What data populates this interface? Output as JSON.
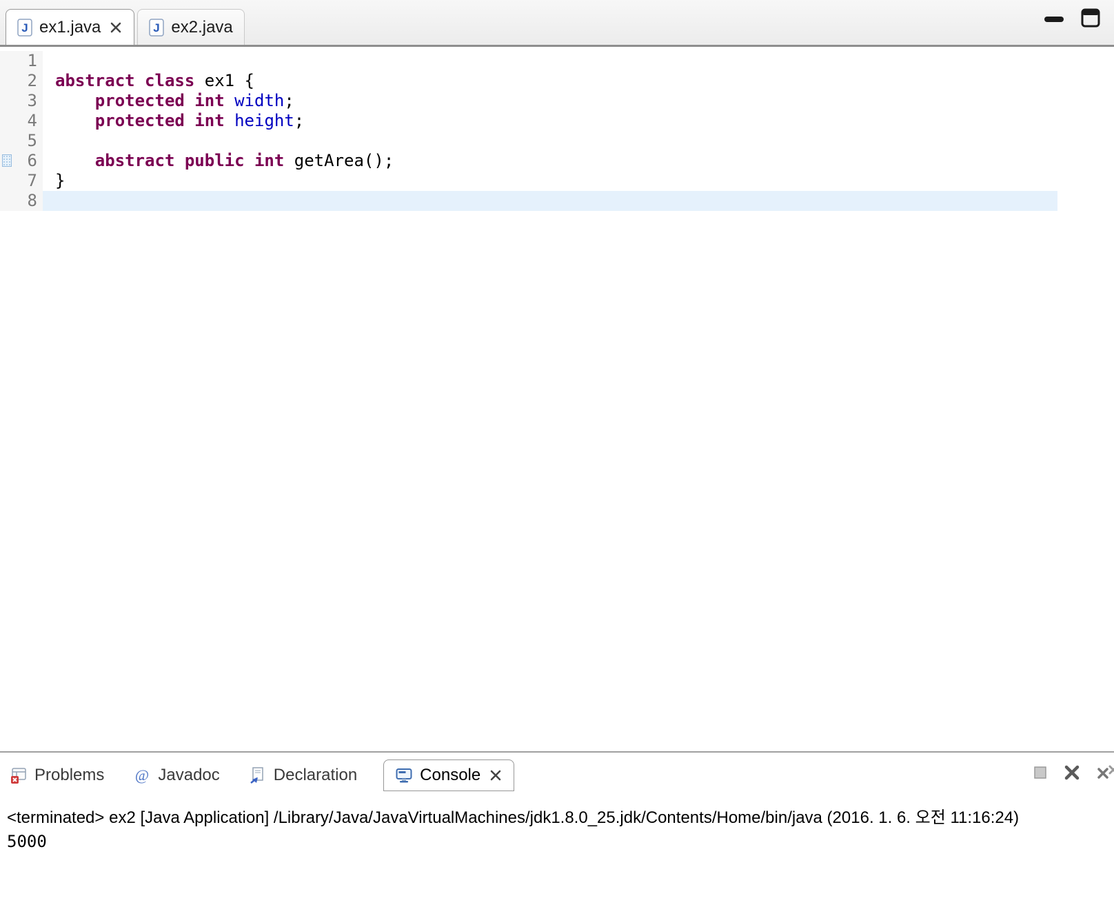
{
  "window": {
    "controls": [
      {
        "icon": "minimize-icon"
      },
      {
        "icon": "maximize-icon"
      }
    ]
  },
  "editor": {
    "tabs": [
      {
        "icon": "java-file-icon",
        "label": "ex1.java",
        "active": true,
        "closable": true,
        "close_icon": "close-icon"
      },
      {
        "icon": "java-file-icon",
        "label": "ex2.java",
        "active": false,
        "closable": false
      }
    ],
    "marker_line": 6,
    "current_line": 8,
    "lines": [
      {
        "num": "1",
        "tokens": []
      },
      {
        "num": "2",
        "tokens": [
          {
            "t": "kw",
            "s": "abstract class "
          },
          {
            "t": "pl",
            "s": "ex1 {"
          }
        ]
      },
      {
        "num": "3",
        "tokens": [
          {
            "t": "pl",
            "s": "    "
          },
          {
            "t": "kw",
            "s": "protected int "
          },
          {
            "t": "field",
            "s": "width"
          },
          {
            "t": "pl",
            "s": ";"
          }
        ]
      },
      {
        "num": "4",
        "tokens": [
          {
            "t": "pl",
            "s": "    "
          },
          {
            "t": "kw",
            "s": "protected int "
          },
          {
            "t": "field",
            "s": "height"
          },
          {
            "t": "pl",
            "s": ";"
          }
        ]
      },
      {
        "num": "5",
        "tokens": []
      },
      {
        "num": "6",
        "tokens": [
          {
            "t": "pl",
            "s": "    "
          },
          {
            "t": "kw",
            "s": "abstract public int "
          },
          {
            "t": "pl",
            "s": "getArea();"
          }
        ]
      },
      {
        "num": "7",
        "tokens": [
          {
            "t": "pl",
            "s": "}"
          }
        ]
      },
      {
        "num": "8",
        "tokens": []
      }
    ]
  },
  "console": {
    "tabs": [
      {
        "icon": "problems-icon",
        "label": "Problems",
        "active": false
      },
      {
        "icon": "javadoc-icon",
        "label": "Javadoc",
        "active": false
      },
      {
        "icon": "declaration-icon",
        "label": "Declaration",
        "active": false
      },
      {
        "icon": "console-icon",
        "label": "Console",
        "active": true,
        "closable": true,
        "close_icon": "close-icon"
      }
    ],
    "toolbar": [
      {
        "icon": "gray-square-icon"
      },
      {
        "icon": "close-console-icon"
      },
      {
        "icon": "remove-all-terminated-icon"
      }
    ],
    "header": "<terminated> ex2 [Java Application] /Library/Java/JavaVirtualMachines/jdk1.8.0_25.jdk/Contents/Home/bin/java (2016. 1. 6. 오전 11:16:24)",
    "output": "5000"
  },
  "colors": {
    "keyword": "#7B0052",
    "field": "#0000C0",
    "plain": "#000000",
    "line_highlight": "#E5F1FC"
  }
}
